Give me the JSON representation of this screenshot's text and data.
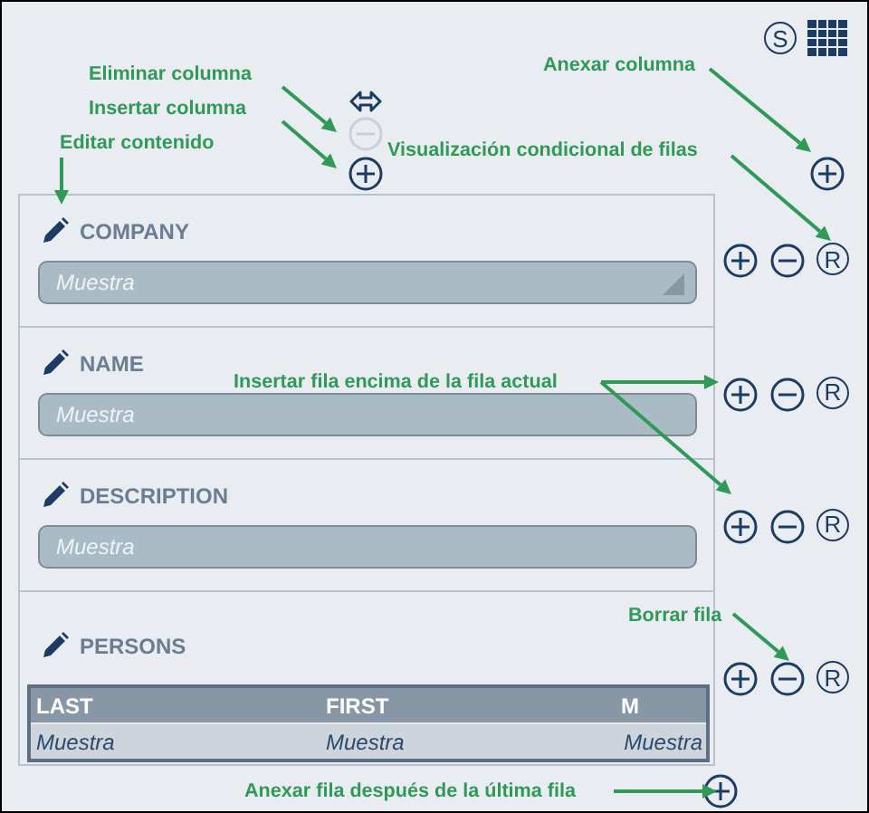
{
  "toolbar": {
    "style_button": "S"
  },
  "column_tools": [
    {
      "kind": "resize",
      "disabled": false
    },
    {
      "kind": "delete",
      "disabled": true
    },
    {
      "kind": "insert",
      "disabled": false
    }
  ],
  "rows": [
    {
      "label": "COMPANY",
      "kind": "combo",
      "placeholder": "Muestra",
      "conditional": "R"
    },
    {
      "label": "NAME",
      "kind": "text",
      "placeholder": "Muestra",
      "conditional": "R"
    },
    {
      "label": "DESCRIPTION",
      "kind": "text",
      "placeholder": "Muestra",
      "conditional": "R"
    },
    {
      "label": "PERSONS",
      "kind": "table",
      "columns": [
        "LAST",
        "FIRST",
        "M"
      ],
      "cells": [
        "Muestra",
        "Muestra",
        "Muestra"
      ],
      "conditional": "R"
    }
  ],
  "annotations": [
    "Eliminar columna",
    "Insertar columna",
    "Editar contenido",
    "Anexar columna",
    "Visualización condicional de filas",
    "Insertar fila encima de la fila actual",
    "Borrar fila",
    "Anexar fila después de la última fila"
  ]
}
